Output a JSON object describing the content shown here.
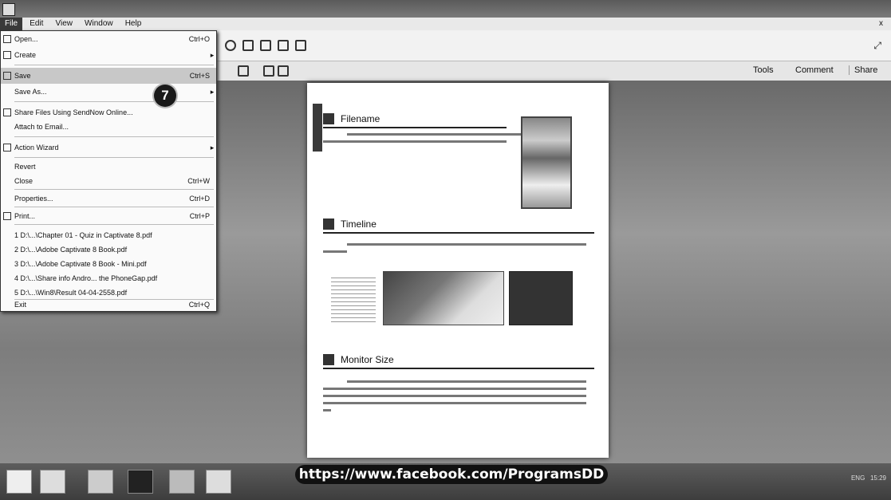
{
  "menubar": {
    "items": [
      "File",
      "Edit",
      "View",
      "Window",
      "Help"
    ],
    "active": "File",
    "close": "x"
  },
  "toolbar": {
    "tabs": [
      "Tools",
      "Comment",
      "Share"
    ]
  },
  "file_menu": {
    "items": [
      {
        "label": "Open...",
        "shortcut": "Ctrl+O"
      },
      {
        "label": "Create",
        "arrow": "▸"
      },
      {
        "label": "Save",
        "shortcut": "Ctrl+S"
      },
      {
        "label": "Save As...",
        "arrow": "▸"
      },
      {
        "label": "Share Files Using SendNow Online..."
      },
      {
        "label": "Attach to Email..."
      },
      {
        "label": "Action Wizard",
        "arrow": "▸"
      },
      {
        "label": "Revert"
      },
      {
        "label": "Close",
        "shortcut": "Ctrl+W"
      },
      {
        "label": "Properties...",
        "shortcut": "Ctrl+D"
      },
      {
        "label": "Print...",
        "shortcut": "Ctrl+P"
      },
      {
        "label": "1 D:\\...\\Chapter 01 - Quiz in Captivate 8.pdf"
      },
      {
        "label": "2 D:\\...\\Adobe Captivate 8 Book.pdf"
      },
      {
        "label": "3 D:\\...\\Adobe Captivate 8 Book - Mini.pdf"
      },
      {
        "label": "4 D:\\...\\Share info Andro... the PhoneGap.pdf"
      },
      {
        "label": "5 D:\\...\\Win8\\Result 04-04-2558.pdf"
      },
      {
        "label": "Exit",
        "shortcut": "Ctrl+Q"
      }
    ],
    "step_badge": "7"
  },
  "document": {
    "sections": [
      "Filename",
      "Timeline",
      "Monitor Size"
    ]
  },
  "overlay": {
    "url": "https://www.facebook.com/ProgramsDD"
  },
  "taskbar": {
    "time": "15:29",
    "lang": "ENG"
  }
}
